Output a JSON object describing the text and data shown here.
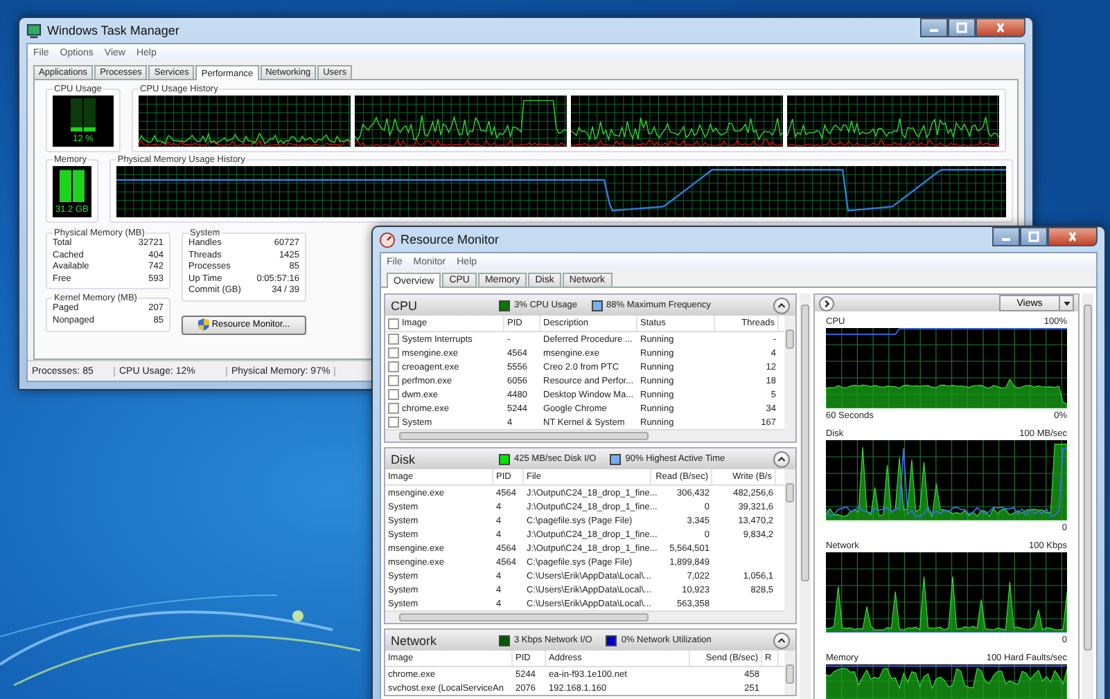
{
  "task_manager": {
    "title": "Windows Task Manager",
    "menu": [
      "File",
      "Options",
      "View",
      "Help"
    ],
    "tabs": [
      {
        "label": "Applications",
        "selected": false
      },
      {
        "label": "Processes",
        "selected": false
      },
      {
        "label": "Services",
        "selected": false
      },
      {
        "label": "Performance",
        "selected": true
      },
      {
        "label": "Networking",
        "selected": false
      },
      {
        "label": "Users",
        "selected": false
      }
    ],
    "cpu_usage": {
      "title": "CPU Usage",
      "reading": "12 %",
      "level": 0.12
    },
    "cpu_history": {
      "title": "CPU Usage History"
    },
    "memory": {
      "title": "Memory",
      "reading": "31.2 GB",
      "level": 0.97
    },
    "memory_history": {
      "title": "Physical Memory Usage History"
    },
    "physical_memory": {
      "title": "Physical Memory (MB)",
      "rows": [
        {
          "label": "Total",
          "value": "32721"
        },
        {
          "label": "Cached",
          "value": "404"
        },
        {
          "label": "Available",
          "value": "742"
        },
        {
          "label": "Free",
          "value": "593"
        }
      ]
    },
    "kernel_memory": {
      "title": "Kernel Memory (MB)",
      "rows": [
        {
          "label": "Paged",
          "value": "207"
        },
        {
          "label": "Nonpaged",
          "value": "85"
        }
      ]
    },
    "system": {
      "title": "System",
      "rows": [
        {
          "label": "Handles",
          "value": "60727"
        },
        {
          "label": "Threads",
          "value": "1425"
        },
        {
          "label": "Processes",
          "value": "85"
        },
        {
          "label": "Up Time",
          "value": "0:05:57:16"
        },
        {
          "label": "Commit (GB)",
          "value": "34 / 39"
        }
      ]
    },
    "resource_monitor_button": "Resource Monitor...",
    "status_bar": [
      "Processes: 85",
      "CPU Usage: 12%",
      "Physical Memory: 97%"
    ]
  },
  "resource_monitor": {
    "title": "Resource Monitor",
    "menu": [
      "File",
      "Monitor",
      "Help"
    ],
    "tabs": [
      {
        "label": "Overview",
        "selected": true
      },
      {
        "label": "CPU",
        "selected": false
      },
      {
        "label": "Memory",
        "selected": false
      },
      {
        "label": "Disk",
        "selected": false
      },
      {
        "label": "Network",
        "selected": false
      }
    ],
    "sections": [
      {
        "kind": "cpu",
        "title": "CPU",
        "indicators": [
          {
            "text": "3% CPU Usage",
            "color": "#007a00"
          },
          {
            "text": "88% Maximum Frequency",
            "color": "#78aef0"
          }
        ],
        "all_checked": false,
        "columns": [
          "Image",
          "PID",
          "Description",
          "Status",
          "Threads"
        ],
        "rows": [
          {
            "checked": false,
            "cells": [
              "System Interrupts",
              "-",
              "Deferred Procedure ...",
              "Running",
              "-"
            ]
          },
          {
            "checked": false,
            "cells": [
              "msengine.exe",
              "4564",
              "msengine.exe",
              "Running",
              "4"
            ]
          },
          {
            "checked": false,
            "cells": [
              "creoagent.exe",
              "5556",
              "Creo 2.0 from PTC",
              "Running",
              "12"
            ]
          },
          {
            "checked": false,
            "cells": [
              "perfmon.exe",
              "6056",
              "Resource and Perfor...",
              "Running",
              "18"
            ]
          },
          {
            "checked": false,
            "cells": [
              "dwm.exe",
              "4480",
              "Desktop Window Ma...",
              "Running",
              "5"
            ]
          },
          {
            "checked": false,
            "cells": [
              "chrome.exe",
              "5244",
              "Google Chrome",
              "Running",
              "34"
            ]
          },
          {
            "checked": false,
            "cells": [
              "System",
              "4",
              "NT Kernel & System",
              "Running",
              "167"
            ]
          }
        ]
      },
      {
        "kind": "disk",
        "title": "Disk",
        "indicators": [
          {
            "text": "425 MB/sec Disk I/O",
            "color": "#00e600"
          },
          {
            "text": "90% Highest Active Time",
            "color": "#78aef0"
          }
        ],
        "columns": [
          "Image",
          "PID",
          "File",
          "Read (B/sec)",
          "Write (B/s"
        ],
        "rows": [
          {
            "cells": [
              "msengine.exe",
              "4564",
              "J:\\Output\\C24_18_drop_1_fine...",
              "306,432",
              "482,256,6"
            ]
          },
          {
            "cells": [
              "System",
              "4",
              "J:\\Output\\C24_18_drop_1_fine...",
              "0",
              "39,321,6"
            ]
          },
          {
            "cells": [
              "System",
              "4",
              "C:\\pagefile.sys (Page File)",
              "3,345",
              "13,470,2"
            ]
          },
          {
            "cells": [
              "System",
              "4",
              "J:\\Output\\C24_18_drop_1_fine...",
              "0",
              "9,834,2"
            ]
          },
          {
            "cells": [
              "msengine.exe",
              "4564",
              "J:\\Output\\C24_18_drop_1_fine...",
              "5,564,501"
            ]
          },
          {
            "cells": [
              "msengine.exe",
              "4564",
              "C:\\pagefile.sys (Page File)",
              "1,899,849"
            ]
          },
          {
            "cells": [
              "System",
              "4",
              "C:\\Users\\Erik\\AppData\\Local\\...",
              "7,022",
              "1,056,1"
            ]
          },
          {
            "cells": [
              "System",
              "4",
              "C:\\Users\\Erik\\AppData\\Local\\...",
              "10,923",
              "828,5"
            ]
          },
          {
            "cells": [
              "System",
              "4",
              "C:\\Users\\Erik\\AppData\\Local\\...",
              "563,358"
            ]
          }
        ]
      },
      {
        "kind": "network",
        "title": "Network",
        "indicators": [
          {
            "text": "3 Kbps Network I/O",
            "color": "#005a00"
          },
          {
            "text": "0% Network Utilization",
            "color": "#0000c8"
          }
        ],
        "columns": [
          "Image",
          "PID",
          "Address",
          "Send (B/sec)",
          "R"
        ],
        "rows": [
          {
            "cells": [
              "chrome.exe",
              "5244",
              "ea-in-f93.1e100.net",
              "458"
            ]
          },
          {
            "cells": [
              "svchost.exe (LocalServiceAn",
              "2076",
              "192.168.1.160",
              "251"
            ]
          }
        ]
      }
    ],
    "views_button": "Views",
    "graphs": [
      {
        "kind": "cpu",
        "title": "CPU",
        "scale": "100%",
        "time_span": "60 Seconds",
        "minimum": "0%"
      },
      {
        "kind": "disk",
        "title": "Disk",
        "scale": "100 MB/sec",
        "minimum": "0"
      },
      {
        "kind": "network",
        "title": "Network",
        "scale": "100 Kbps",
        "minimum": "0"
      },
      {
        "kind": "memory",
        "title": "Memory",
        "scale": "100 Hard Faults/sec"
      }
    ]
  }
}
